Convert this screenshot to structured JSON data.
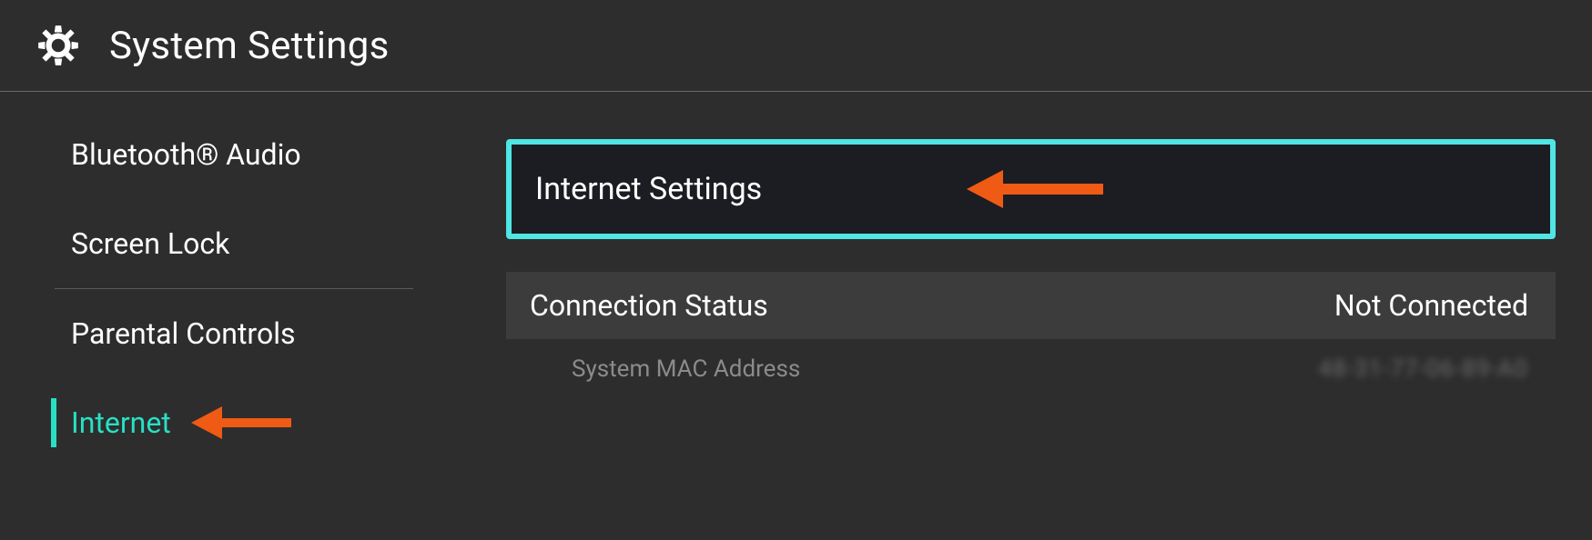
{
  "header": {
    "title": "System Settings"
  },
  "sidebar": {
    "items": [
      {
        "label": "Bluetooth® Audio"
      },
      {
        "label": "Screen Lock"
      },
      {
        "label": "Parental Controls"
      },
      {
        "label": "Internet",
        "active": true
      }
    ]
  },
  "main": {
    "internet_settings_label": "Internet Settings",
    "connection_status": {
      "label": "Connection Status",
      "value": "Not Connected"
    },
    "mac": {
      "label": "System MAC Address",
      "value": "48-31-77-06-89-A0"
    }
  },
  "colors": {
    "accent": "#29dfc4",
    "highlight_border": "#4fe6e4",
    "annotation": "#ef5a14"
  }
}
